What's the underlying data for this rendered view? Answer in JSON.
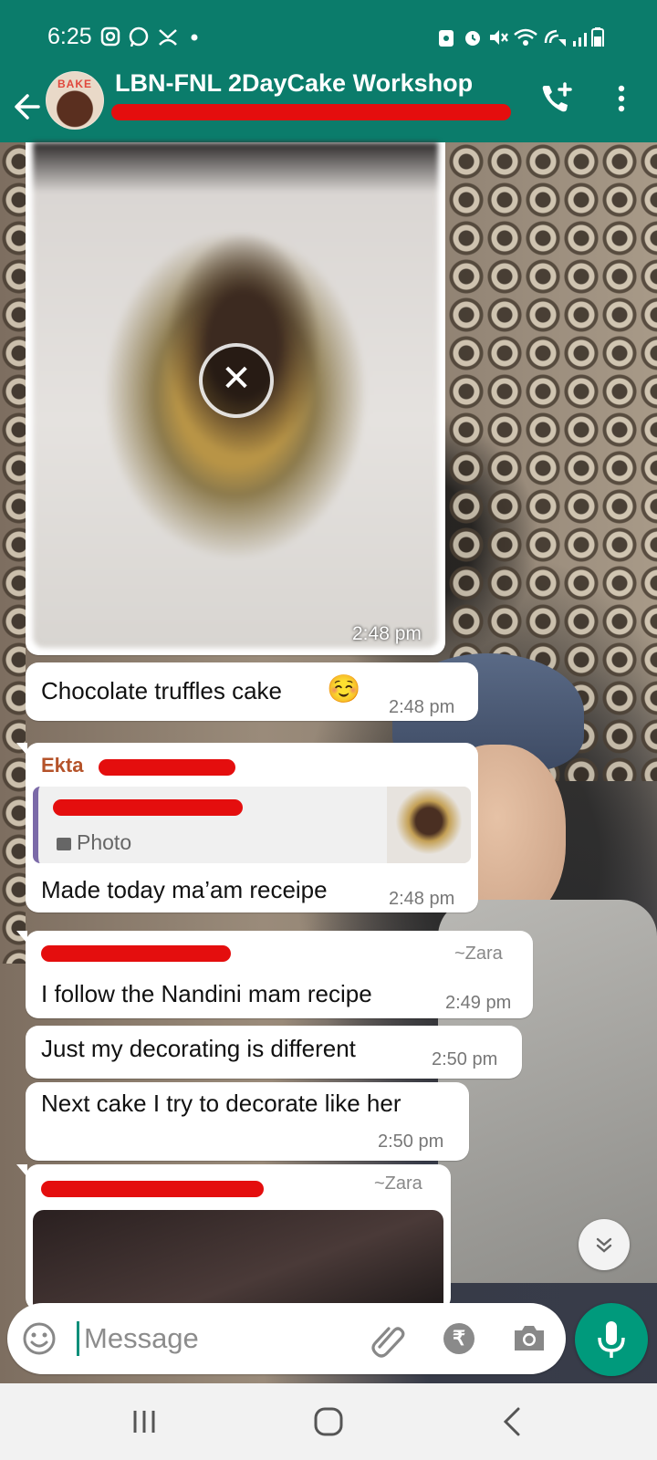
{
  "status_bar": {
    "time": "6:25",
    "left_icons": [
      "instagram-icon",
      "whatsapp-icon",
      "missed-call-icon",
      "dot-icon"
    ],
    "right_icons": [
      "vpn-lock-icon",
      "alarm-icon",
      "mute-icon",
      "wifi-icon",
      "wifi-call-icon",
      "signal-icon",
      "battery-icon"
    ]
  },
  "header": {
    "title": "LBN-FNL 2DayCake Workshop",
    "avatar_text": "BAKE",
    "accent": "#0b7c6b"
  },
  "messages": {
    "image_time": "2:48 pm",
    "m1": {
      "text": "Chocolate truffles cake",
      "emoji": "☺️",
      "time": "2:48 pm"
    },
    "m2": {
      "sender": "Ekta",
      "quote_label": "Photo",
      "text": "Made today ma’am receipe",
      "time": "2:48 pm"
    },
    "m3": {
      "sender_alias": "~Zara",
      "text": "I follow the Nandini mam recipe",
      "time": "2:49 pm"
    },
    "m4": {
      "text": "Just my decorating is different",
      "time": "2:50 pm"
    },
    "m5": {
      "text": "Next cake I try to decorate like her",
      "time": "2:50 pm"
    },
    "m6": {
      "sender_alias": "~Zara"
    }
  },
  "input": {
    "placeholder": "Message",
    "rupee_symbol": "₹"
  },
  "colors": {
    "header_bg": "#0b7c6b",
    "mic_bg": "#009a7c",
    "redaction": "#e40e0e",
    "sender_ekta": "#b5532a"
  }
}
